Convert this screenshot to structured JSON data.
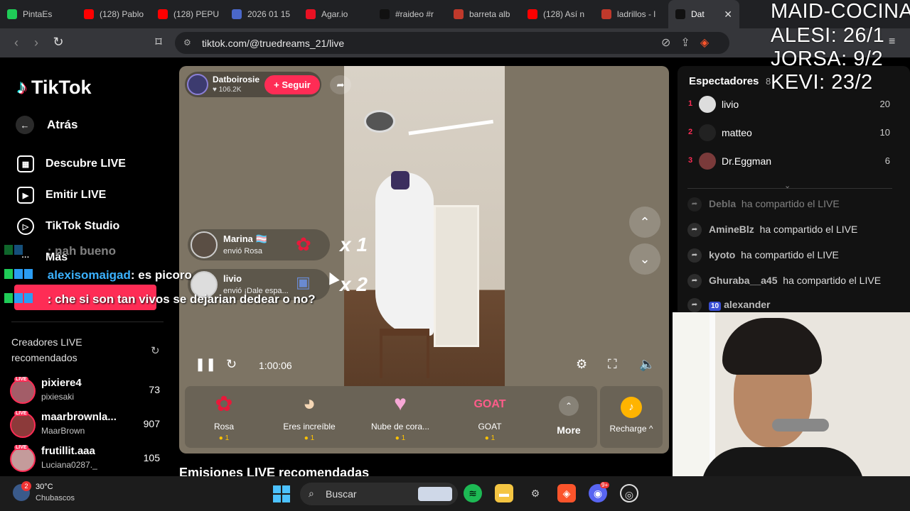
{
  "browser": {
    "tabs": [
      {
        "label": "PintaEs",
        "color": "#1fcc57"
      },
      {
        "label": "(128) Pablo",
        "color": "#ff0000"
      },
      {
        "label": "(128) PEPU",
        "color": "#ff0000"
      },
      {
        "label": "2026 01 15",
        "color": "#4a67c9"
      },
      {
        "label": "Agar.io",
        "color": "#e81123"
      },
      {
        "label": "#raideo #r",
        "color": "#111111"
      },
      {
        "label": "barreta alb",
        "color": "#c0392b"
      },
      {
        "label": "(128) Así n",
        "color": "#ff0000"
      },
      {
        "label": "ladrillos - l",
        "color": "#c0392b"
      },
      {
        "label": "Dat",
        "color": "#111111"
      }
    ],
    "url": "tiktok.com/@truedreams_21/live"
  },
  "sidebar": {
    "logo": "TikTok",
    "back_label": "Atrás",
    "nav": [
      {
        "label": "Descubre LIVE",
        "icon": "calendar-live-icon"
      },
      {
        "label": "Emitir LIVE",
        "icon": "camera-icon"
      },
      {
        "label": "TikTok Studio",
        "icon": "studio-icon"
      },
      {
        "label": "Más",
        "icon": "more-icon"
      }
    ],
    "recommended_title": "Creadores LIVE recomendados",
    "creators": [
      {
        "name": "pixiere4",
        "handle": "pixiesaki",
        "count": "73"
      },
      {
        "name": "maarbrownla...",
        "handle": "MaarBrown",
        "count": "907"
      },
      {
        "name": "frutillit.aaa",
        "handle": "Luciana0287._",
        "count": "105"
      }
    ],
    "live_badge": "LIVE"
  },
  "live": {
    "host_name": "Datboirosie",
    "host_likes": "♥ 106.2K",
    "follow_label": "+ Seguir",
    "gift_messages": [
      {
        "user": "Marina 🏳️‍⚧️",
        "text": "envió Rosa",
        "gift_icon": "rose-icon",
        "multiplier": "x 1"
      },
      {
        "user": "livio",
        "text": "envió ¡Dale espa...",
        "gift_icon": "gift-image-icon",
        "multiplier": "x 2"
      }
    ],
    "elapsed": "1:00:06",
    "gifts": [
      {
        "name": "Rosa",
        "cost": "1",
        "icon": "rose-icon"
      },
      {
        "name": "Eres increíble",
        "cost": "1",
        "icon": "cat-icon"
      },
      {
        "name": "Nube de cora...",
        "cost": "1",
        "icon": "heart-cloud-icon"
      },
      {
        "name": "GOAT",
        "cost": "1",
        "icon": "goat-icon"
      }
    ],
    "more_label": "More",
    "recharge_label": "Recharge ^",
    "recommended_streams": "Emisiones LIVE recomendadas"
  },
  "viewers": {
    "title": "Espectadores",
    "count": "8",
    "top": [
      {
        "rank": "1",
        "name": "livio",
        "score": "20"
      },
      {
        "rank": "2",
        "name": "matteo",
        "score": "10"
      },
      {
        "rank": "3",
        "name": "Dr.Eggman",
        "score": "6"
      }
    ],
    "shares": [
      {
        "user": "Debla",
        "text": "ha compartido el LIVE"
      },
      {
        "user": "AmineBlz",
        "text": "ha compartido el LIVE"
      },
      {
        "user": "kyoto",
        "text": "ha compartido el LIVE"
      },
      {
        "user": "Ghuraba__a45",
        "text": "ha compartido el LIVE"
      },
      {
        "user": "alexander",
        "text": "",
        "level": "10"
      }
    ]
  },
  "overlay": {
    "lines": [
      "MAID-COCINA",
      "ALESI: 26/1",
      "JORSA: 9/2",
      "KEVI: 23/2"
    ]
  },
  "stream_chat": [
    {
      "user": "",
      "message": ": nah bueno"
    },
    {
      "user": "alexisomaigad",
      "message": ": es picoro"
    },
    {
      "user": "",
      "message": ": che si son tan vivos se dejarian dedear o no?"
    }
  ],
  "taskbar": {
    "temp": "30°C",
    "weather": "Chubascos",
    "weather_badge": "2",
    "search_label": "Buscar",
    "discord_badge": "9+"
  }
}
